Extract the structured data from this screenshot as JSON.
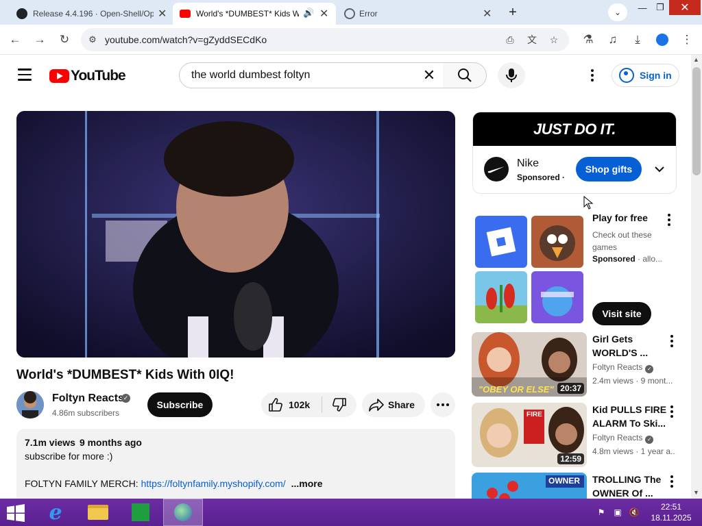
{
  "browser": {
    "tabs": [
      {
        "title": "Release 4.4.196 · Open-Shell/Op",
        "icon": "github-icon"
      },
      {
        "title": "World's *DUMBEST* Kids W",
        "icon": "youtube-icon"
      },
      {
        "title": "Error",
        "icon": "globe-icon"
      }
    ],
    "url": "youtube.com/watch?v=gZyddSECdKo"
  },
  "youtube": {
    "logo_text": "YouTube",
    "search_query": "the world dumbest foltyn",
    "sign_in": "Sign in"
  },
  "video": {
    "title": "World's *DUMBEST* Kids With 0IQ!",
    "channel": "Foltyn Reacts",
    "subscribers": "4.86m subscribers",
    "subscribe_label": "Subscribe",
    "likes": "102k",
    "share_label": "Share",
    "views": "7.1m views",
    "age": "9 months ago",
    "desc_line1": "subscribe for more :)",
    "merch_label": "FOLTYN FAMILY MERCH: ",
    "merch_link": "https://foltynfamily.myshopify.com/",
    "more_label": "...more"
  },
  "ad": {
    "banner": "JUST DO IT.",
    "brand": "Nike",
    "sponsored": "Sponsored ·",
    "cta": "Shop gifts"
  },
  "game_ad": {
    "title": "Play for free",
    "desc": "Check out these games",
    "sponsored": "Sponsored",
    "sponsored_extra": " · allo...",
    "cta": "Visit site"
  },
  "recommendations": [
    {
      "title": "Girl Gets WORLD'S ...",
      "channel": "Foltyn Reacts",
      "meta": "2.4m views · 9 mont...",
      "duration": "20:37",
      "thumb_caption": "\"OBEY OR ELSE\""
    },
    {
      "title": "Kid PULLS FIRE ALARM To Ski...",
      "channel": "Foltyn Reacts",
      "meta": "4.8m views · 1 year a...",
      "duration": "12:59",
      "thumb_caption": "FIRE"
    },
    {
      "title": "TROLLING The OWNER Of ...",
      "channel": "",
      "meta": "",
      "duration": "",
      "thumb_caption": "OWNER"
    }
  ],
  "taskbar": {
    "time": "22:51",
    "date": "18.11.2025"
  }
}
